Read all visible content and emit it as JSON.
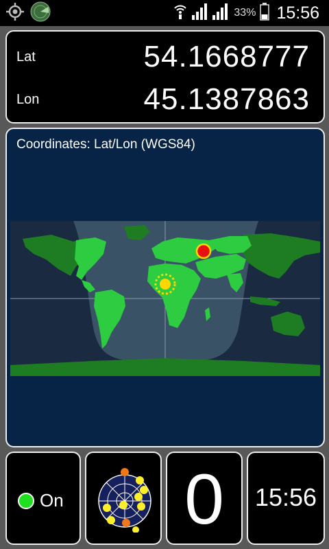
{
  "status_bar": {
    "icons": [
      "gps-locate-icon",
      "radar-app-icon",
      "wifi-icon",
      "signal-icon",
      "signal-icon",
      "battery-icon"
    ],
    "battery": "33%",
    "time": "15:56"
  },
  "coordinates": {
    "lat_label": "Lat",
    "lat_value": "54.1668777",
    "lon_label": "Lon",
    "lon_value": "45.1387863"
  },
  "map": {
    "title": "Coordinates: Lat/Lon (WGS84)",
    "colors": {
      "ocean_day": "#3a5266",
      "ocean_night": "#1a2a40",
      "land_day": "#2ecc40",
      "land_night": "#1e7d22",
      "position_marker": "#e81010",
      "sun": "#ffd700"
    },
    "position": {
      "lat": 54.1668777,
      "lon": 45.1387863
    }
  },
  "gps": {
    "state": "On",
    "color": "#1fdf1f"
  },
  "satellites": {
    "count": "0",
    "colors": {
      "in_use": "#ffef2b",
      "not_used": "#f07818"
    }
  },
  "clock": {
    "time": "15:56"
  }
}
